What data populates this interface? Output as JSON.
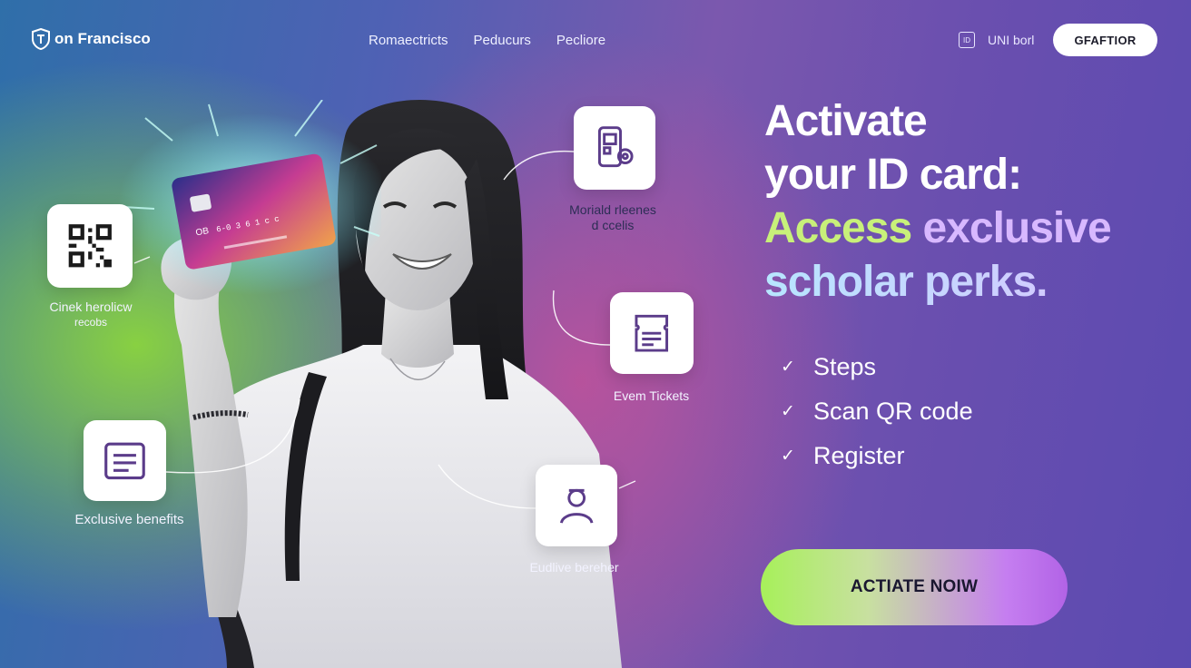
{
  "header": {
    "brand": "on Francisco",
    "nav": [
      "Romaectricts",
      "Peducurs",
      "Pecliore"
    ],
    "id_link_icon": "ID",
    "id_link": "UNI borl",
    "button": "GFAFTIOR"
  },
  "hero": {
    "headline": {
      "line1": "Activate",
      "line2": "your ID card:",
      "line3a": "Access",
      "line3b": "exclusive",
      "line4": "scholar perks."
    },
    "steps": [
      "Steps",
      "Scan QR code",
      "Register"
    ],
    "cta": "ACTIATE NOIW"
  },
  "features": {
    "qr": {
      "icon": "qr-code-icon",
      "caption_l1": "Cinek herolicw",
      "caption_l2": "recobs"
    },
    "mobile": {
      "icon": "mobile-settings-icon",
      "caption_l1": "Moriald rleenes",
      "caption_l2": "d ccelis"
    },
    "tickets": {
      "icon": "ticket-icon",
      "caption": "Evem Tickets"
    },
    "benefits": {
      "icon": "list-icon",
      "caption": "Exclusive benefits"
    },
    "perks": {
      "icon": "person-icon",
      "caption": "Eudlive bereher"
    }
  },
  "card": {
    "chip_text": "OB",
    "number_text": "6-0 3 6 1 c c"
  },
  "colors": {
    "green_glow": "#8cd63c",
    "accent_green": "#c8f07a",
    "accent_purple": "#d8b8ff",
    "cta_start": "#a7f05a",
    "cta_end": "#b263e6"
  }
}
